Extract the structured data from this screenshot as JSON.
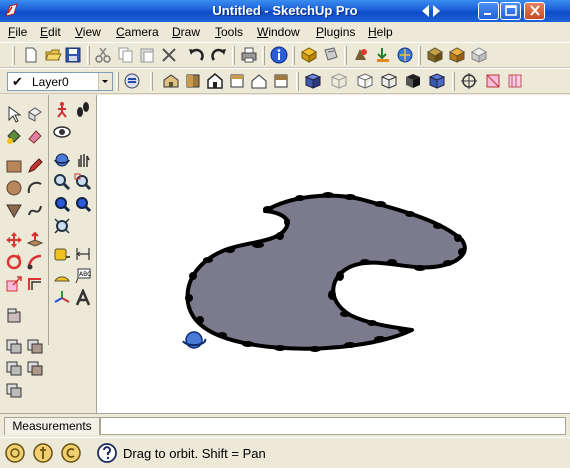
{
  "window": {
    "title": "Untitled - SketchUp Pro"
  },
  "menu": [
    {
      "label": "File",
      "u": "F",
      "rest": "ile"
    },
    {
      "label": "Edit",
      "u": "E",
      "rest": "dit"
    },
    {
      "label": "View",
      "u": "V",
      "rest": "iew"
    },
    {
      "label": "Camera",
      "u": "C",
      "rest": "amera"
    },
    {
      "label": "Draw",
      "u": "D",
      "rest": "raw"
    },
    {
      "label": "Tools",
      "u": "T",
      "rest": "ools"
    },
    {
      "label": "Window",
      "u": "W",
      "rest": "indow"
    },
    {
      "label": "Plugins",
      "u": "P",
      "rest": "lugins"
    },
    {
      "label": "Help",
      "u": "H",
      "rest": "elp"
    }
  ],
  "layers": {
    "current": "Layer0"
  },
  "measurements": {
    "label": "Measurements",
    "value": ""
  },
  "status": {
    "hint": "Drag to orbit.  Shift = Pan"
  },
  "colors": {
    "title_bar": "#1c5fd6",
    "face_fill": "#7c7b8e",
    "edge": "#000000",
    "canvas": "#ffffff"
  },
  "icons": {
    "toolbar1": [
      "new-icon",
      "open-icon",
      "save-icon",
      "cut-icon",
      "copy-icon",
      "paste-icon",
      "erase-icon",
      "undo-icon",
      "redo-icon",
      "print-icon",
      "model-info-icon",
      "make-component-icon",
      "paint-icon",
      "google-earth-icon",
      "get-models-icon",
      "share-model-icon",
      "component-icon",
      "warehouse-icon",
      "extension-icon"
    ],
    "toolbar2": [
      "layers-icon",
      "iso-view-icon",
      "top-view-icon",
      "front-view-icon",
      "right-view-icon",
      "back-view-icon",
      "left-view-icon",
      "xray-icon",
      "wireframe-icon",
      "hidden-line-icon",
      "shaded-icon",
      "shaded-texture-icon",
      "monochrome-icon",
      "section-plane-icon",
      "section-cut-icon",
      "section-display-icon"
    ]
  }
}
